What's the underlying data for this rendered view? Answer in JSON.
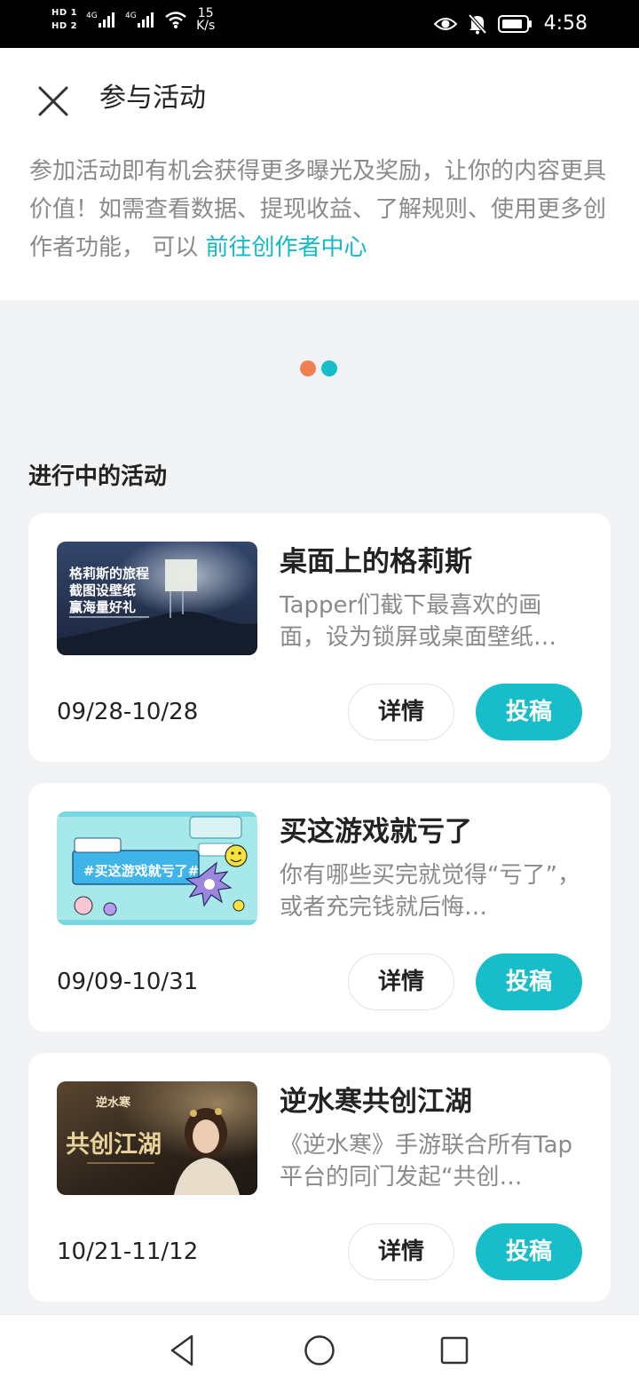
{
  "status_bar": {
    "sim1": "HD 1",
    "sim2": "HD 2",
    "speed_value": "15",
    "speed_unit": "K/s",
    "time": "4:58"
  },
  "header": {
    "title": "参与活动",
    "intro": "参加活动即有机会获得更多曝光及奖励，让你的内容更具价值！如需查看数据、提现收益、了解规则、使用更多创作者功能， 可以 ",
    "intro_link": "前往创作者中心"
  },
  "banner": {
    "dot_colors": [
      "#f08050",
      "#17bec9"
    ]
  },
  "section": {
    "title": "进行中的活动"
  },
  "activities": [
    {
      "title": "桌面上的格莉斯",
      "desc": "Tapper们截下最喜欢的画面，设为锁屏或桌面壁纸…",
      "date": "09/28-10/28",
      "thumb_text": [
        "格莉斯的旅程",
        "截图设壁纸",
        "赢海量好礼"
      ],
      "detail_label": "详情",
      "submit_label": "投稿"
    },
    {
      "title": "买这游戏就亏了",
      "desc": "你有哪些买完就觉得“亏了”，或者充完钱就后悔…",
      "date": "09/09-10/31",
      "thumb_text": [
        "#买这游戏就亏了#"
      ],
      "detail_label": "详情",
      "submit_label": "投稿"
    },
    {
      "title": "逆水寒共创江湖",
      "desc": "《逆水寒》手游联合所有Tap平台的同门发起“共创…",
      "date": "10/21-11/12",
      "thumb_text": [
        "共创江湖",
        "逆水寒"
      ],
      "detail_label": "详情",
      "submit_label": "投稿"
    }
  ],
  "colors": {
    "accent": "#17bec9",
    "link": "#14b9c8"
  }
}
